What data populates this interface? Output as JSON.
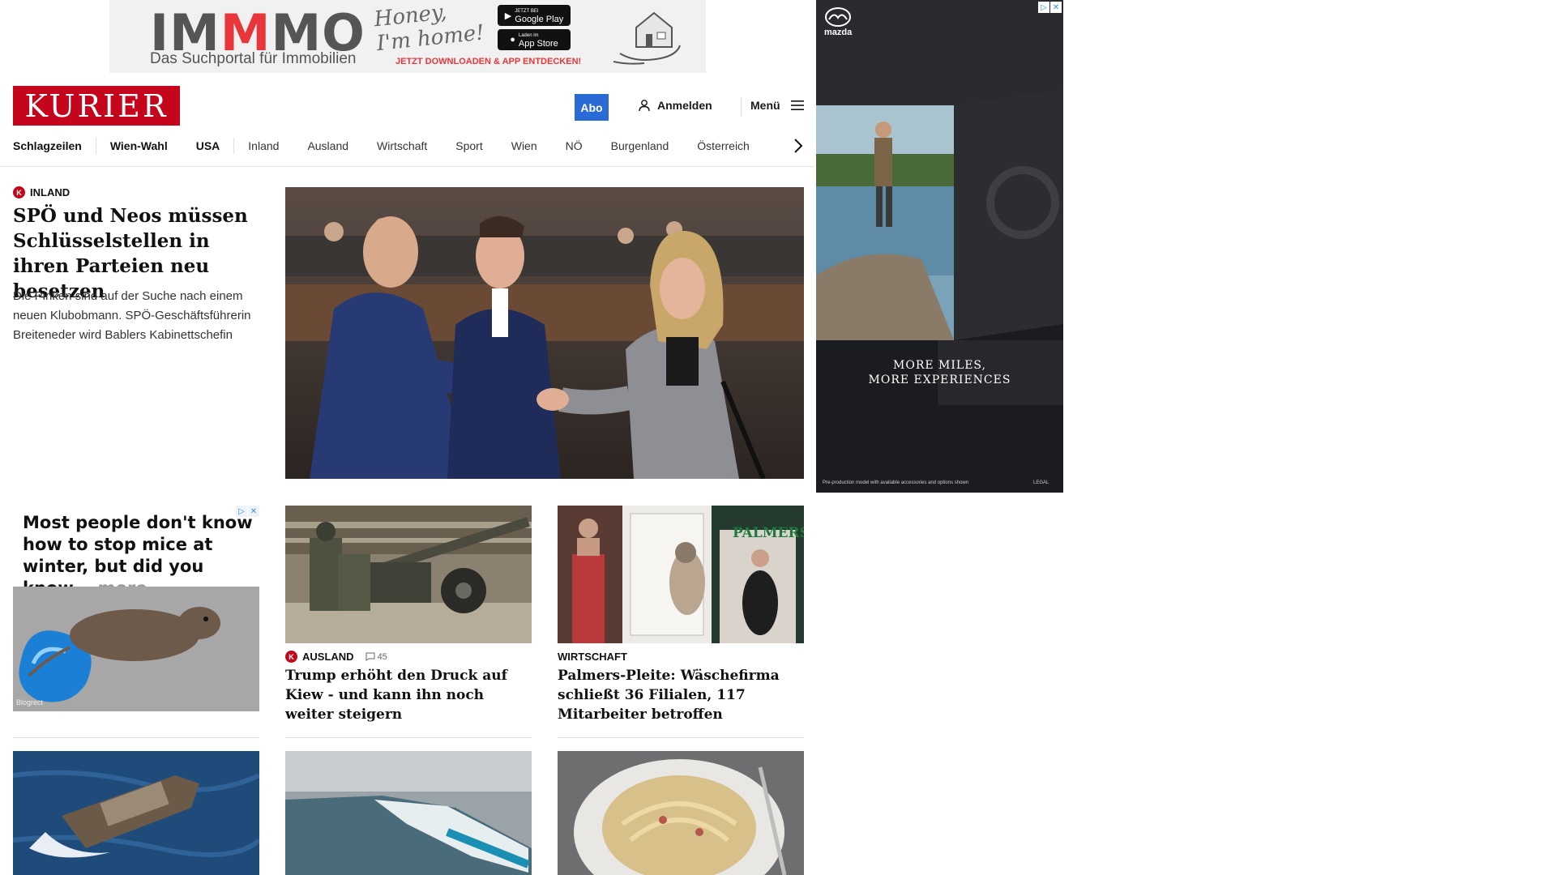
{
  "top_ad": {
    "brand_a": "IM",
    "brand_b": "M",
    "brand_c": "MO",
    "tagline": "Das Suchportal für Immobilien",
    "script_text": "Honey, I'm home!",
    "google_play_small": "JETZT BEI",
    "google_play": "Google Play",
    "app_store_small": "Laden im",
    "app_store": "App Store",
    "cta": "JETZT DOWNLOADEN & APP ENTDECKEN!"
  },
  "header": {
    "logo": "KURIER",
    "abo": "Abo",
    "login": "Anmelden",
    "menu": "Menü"
  },
  "nav": {
    "items": [
      "Schlagzeilen",
      "Wien-Wahl",
      "USA",
      "Inland",
      "Ausland",
      "Wirtschaft",
      "Sport",
      "Wien",
      "NÖ",
      "Burgenland",
      "Österreich"
    ]
  },
  "lead": {
    "kicker": "INLAND",
    "title": "SPÖ und Neos müssen Schlüsselstellen in ihren Parteien neu besetzen",
    "teaser": "Die Pinken sind auf der Suche nach einem neuen Klubobmann. SPÖ-Geschäftsführerin Breiteneder wird Bablers Kabinettschefin"
  },
  "side_ad": {
    "brand": "mazda",
    "headline_1": "MORE MILES,",
    "headline_2": "MORE EXPERIENCES",
    "footnote": "Pre-production model with available accessories and options shown",
    "legal": "LEGAL"
  },
  "mice_ad": {
    "text": "Most people don't know how to stop mice at winter, but did you know...",
    "more": "more",
    "source": "Blogrect"
  },
  "cards": [
    {
      "kicker": "AUSLAND",
      "comments": "45",
      "title": "Trump erhöht den Druck auf Kiew - und kann ihn noch weiter steigern"
    },
    {
      "kicker": "WIRTSCHAFT",
      "title": "Palmers-Pleite: Wäschefirma schließt 36 Filialen, 117 Mitarbeiter betroffen",
      "store_sign": "PALMERS"
    }
  ],
  "colors": {
    "brand_red": "#c4051c",
    "abo_blue": "#2a6ad6",
    "immmo_red": "#e8363a"
  }
}
